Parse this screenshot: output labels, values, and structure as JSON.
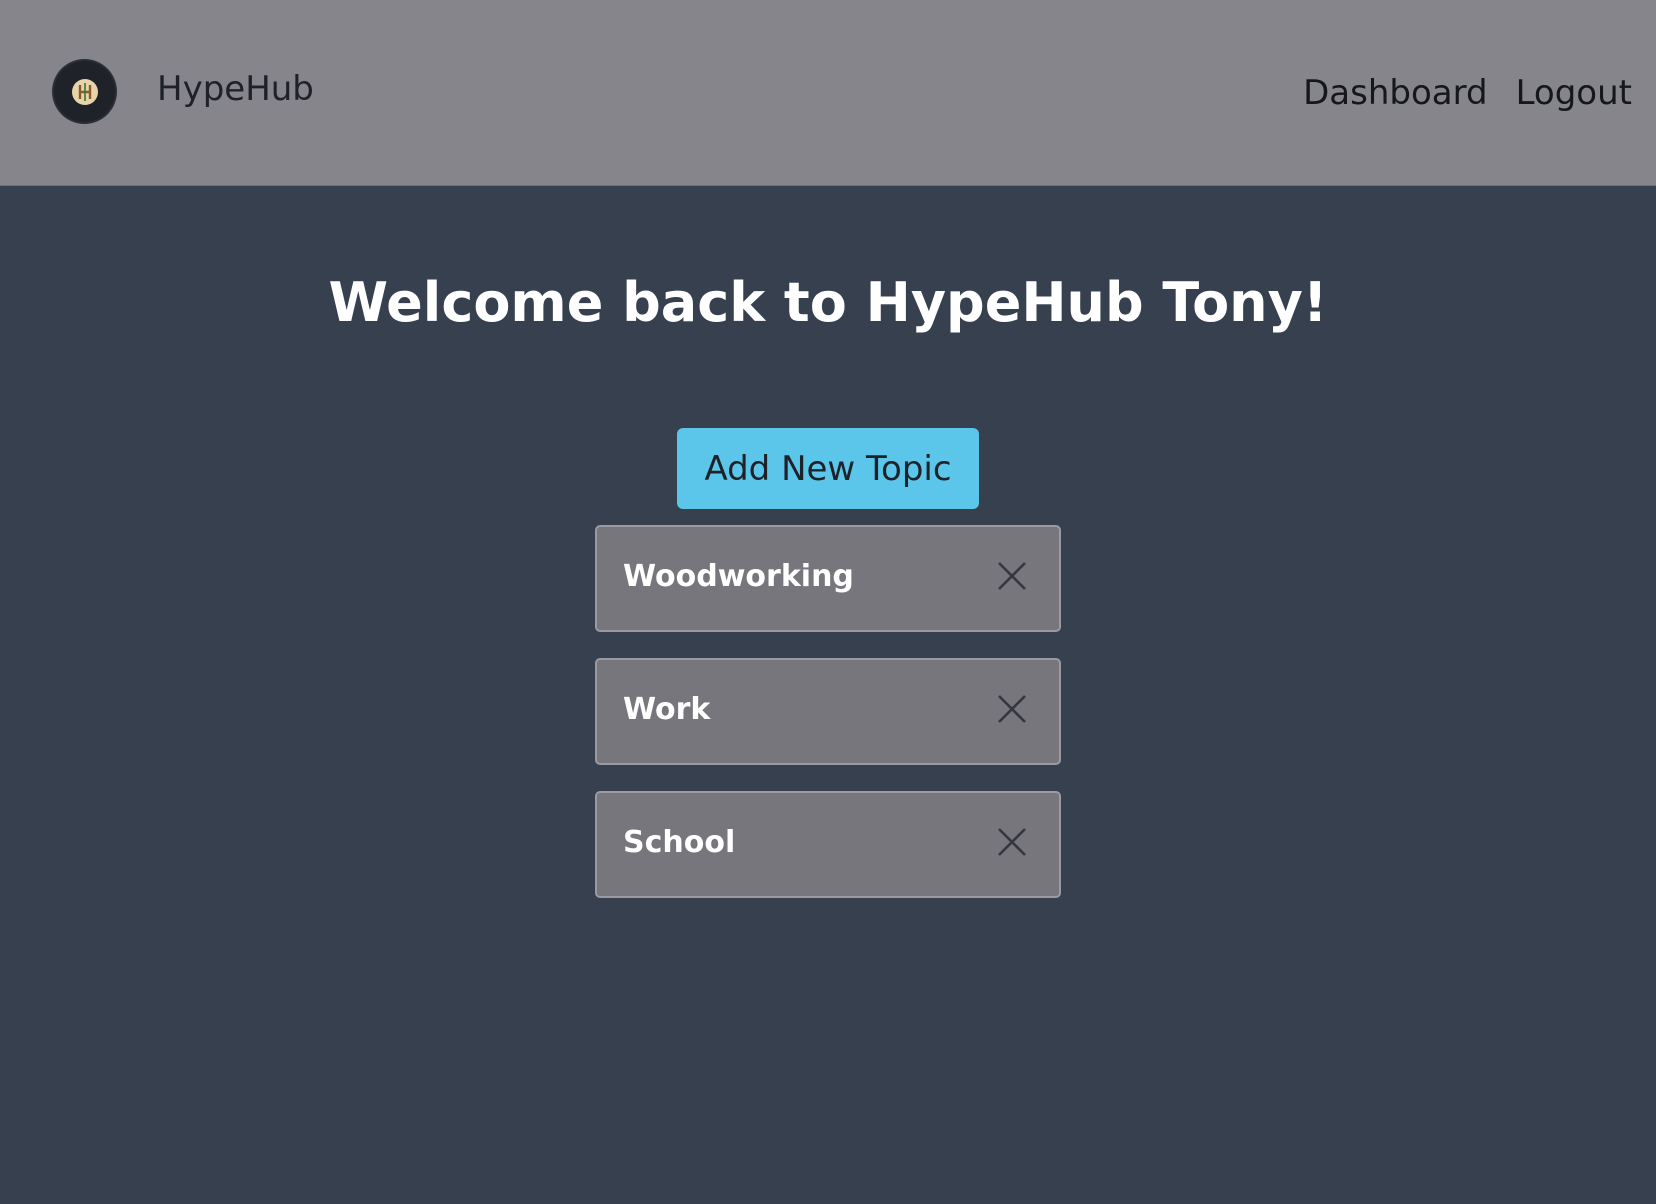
{
  "brand": {
    "name": "HypeHub",
    "logo_icon": "hypehub-logo-icon"
  },
  "nav": {
    "dashboard": "Dashboard",
    "logout": "Logout"
  },
  "main": {
    "welcome": "Welcome back to HypeHub Tony!",
    "add_topic_label": "Add New Topic",
    "topics": [
      {
        "name": "Woodworking",
        "remove_icon": "close-icon"
      },
      {
        "name": "Work",
        "remove_icon": "close-icon"
      },
      {
        "name": "School",
        "remove_icon": "close-icon"
      }
    ]
  },
  "colors": {
    "navbar_bg": "#86858b",
    "page_bg": "#36404e",
    "accent_button": "#5bc6ea",
    "topic_card_bg": "#77767c"
  }
}
